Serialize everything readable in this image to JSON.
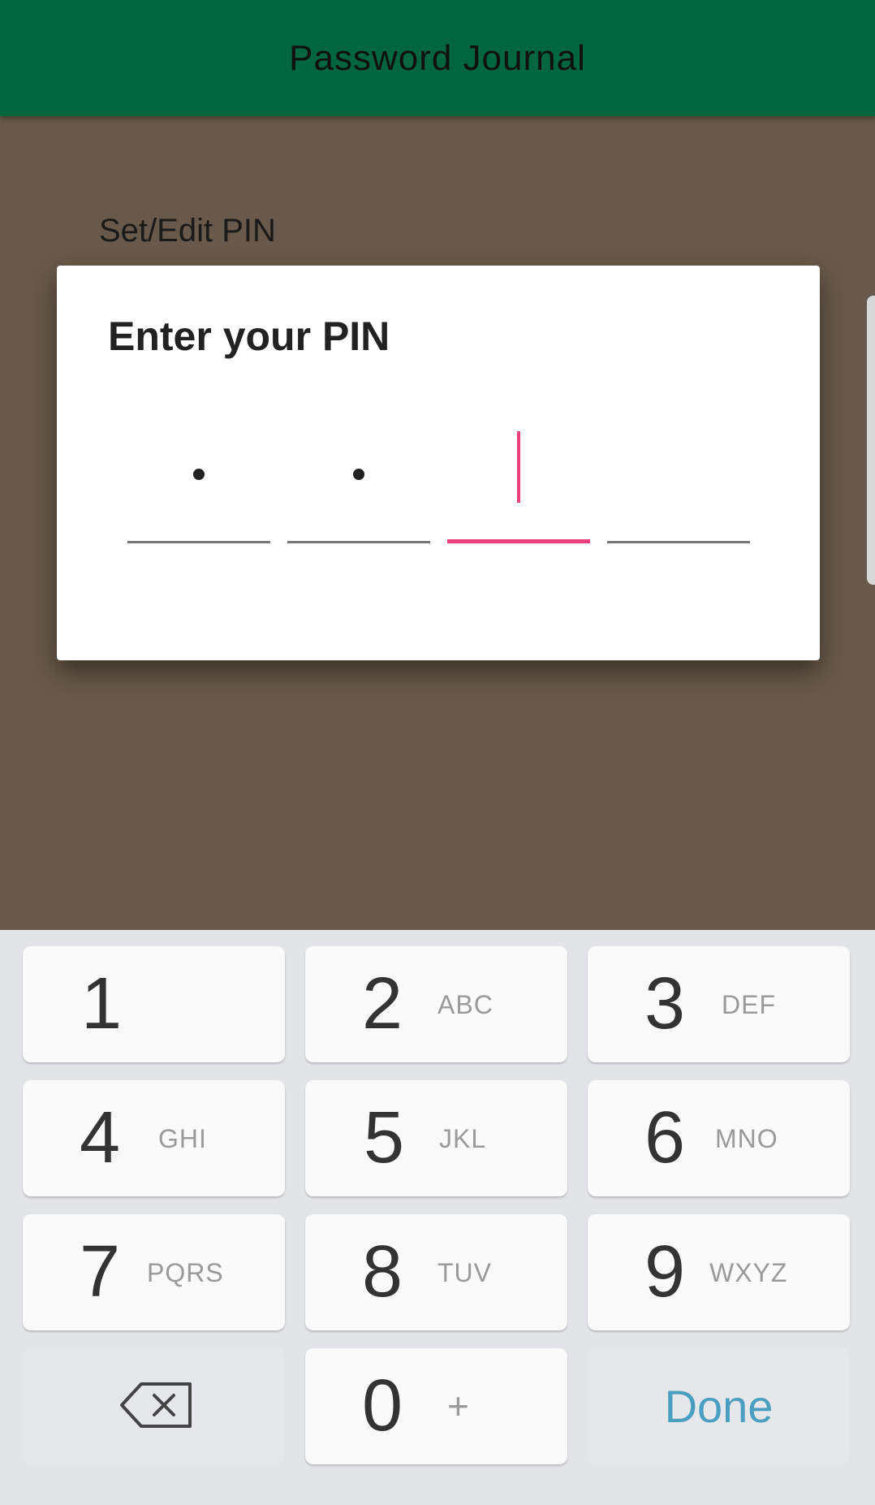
{
  "app": {
    "title": "Password Journal"
  },
  "background": {
    "setting_label": "Set/Edit PIN"
  },
  "dialog": {
    "title": "Enter your PIN",
    "pin_length": 4,
    "filled_count": 2,
    "accent_color": "#ec407a"
  },
  "keypad": {
    "keys": [
      {
        "digit": "1",
        "letters": ""
      },
      {
        "digit": "2",
        "letters": "ABC"
      },
      {
        "digit": "3",
        "letters": "DEF"
      },
      {
        "digit": "4",
        "letters": "GHI"
      },
      {
        "digit": "5",
        "letters": "JKL"
      },
      {
        "digit": "6",
        "letters": "MNO"
      },
      {
        "digit": "7",
        "letters": "PQRS"
      },
      {
        "digit": "8",
        "letters": "TUV"
      },
      {
        "digit": "9",
        "letters": "WXYZ"
      },
      {
        "digit": "0",
        "letters": "+"
      }
    ],
    "backspace_icon": "backspace-icon",
    "done_label": "Done",
    "done_color": "#4a9ec0"
  },
  "colors": {
    "toolbar": "#006640",
    "scrim": "#68594a",
    "keypad_bg": "#e3e4e8"
  }
}
